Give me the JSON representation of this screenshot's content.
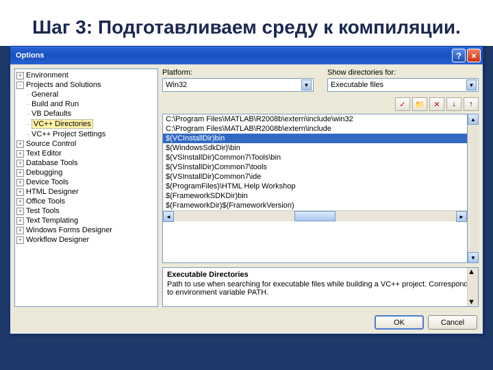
{
  "slide": {
    "title": "Шаг 3: Подготавливаем среду к компиляции."
  },
  "dialog": {
    "title": "Options",
    "help": "?",
    "close": "×"
  },
  "tree": {
    "items": [
      {
        "label": "Environment",
        "toggle": "+",
        "depth": 0
      },
      {
        "label": "Projects and Solutions",
        "toggle": "-",
        "depth": 0
      },
      {
        "label": "General",
        "toggle": "",
        "depth": 1
      },
      {
        "label": "Build and Run",
        "toggle": "",
        "depth": 1
      },
      {
        "label": "VB Defaults",
        "toggle": "",
        "depth": 1
      },
      {
        "label": "VC++ Directories",
        "toggle": "",
        "depth": 1,
        "selected": true
      },
      {
        "label": "VC++ Project Settings",
        "toggle": "",
        "depth": 1
      },
      {
        "label": "Source Control",
        "toggle": "+",
        "depth": 0
      },
      {
        "label": "Text Editor",
        "toggle": "+",
        "depth": 0
      },
      {
        "label": "Database Tools",
        "toggle": "+",
        "depth": 0
      },
      {
        "label": "Debugging",
        "toggle": "+",
        "depth": 0
      },
      {
        "label": "Device Tools",
        "toggle": "+",
        "depth": 0
      },
      {
        "label": "HTML Designer",
        "toggle": "+",
        "depth": 0
      },
      {
        "label": "Office Tools",
        "toggle": "+",
        "depth": 0
      },
      {
        "label": "Test Tools",
        "toggle": "+",
        "depth": 0
      },
      {
        "label": "Text Templating",
        "toggle": "+",
        "depth": 0
      },
      {
        "label": "Windows Forms Designer",
        "toggle": "+",
        "depth": 0
      },
      {
        "label": "Workflow Designer",
        "toggle": "+",
        "depth": 0
      }
    ]
  },
  "right": {
    "platform_label": "Platform:",
    "platform_value": "Win32",
    "showdirs_label": "Show directories for:",
    "showdirs_value": "Executable files",
    "toolbar": {
      "check": "✓",
      "new": "📁",
      "delete": "✕",
      "down": "↓",
      "up": "↑"
    },
    "paths": [
      "C:\\Program Files\\MATLAB\\R2008b\\extern\\include\\win32",
      "C:\\Program Files\\MATLAB\\R2008b\\extern\\include",
      "$(VCInstallDir)bin",
      "$(WindowsSdkDir)\\bin",
      "$(VSInstallDir)Common7\\Tools\\bin",
      "$(VSInstallDir)Common7\\tools",
      "$(VSInstallDir)Common7\\ide",
      "$(ProgramFiles)\\HTML Help Workshop",
      "$(FrameworkSDKDir)bin",
      "$(FrameworkDir)$(FrameworkVersion)"
    ],
    "selected_index": 2,
    "desc": {
      "title": "Executable Directories",
      "text": "Path to use when searching for executable files while building a VC++ project.  Corresponds to environment variable PATH."
    }
  },
  "buttons": {
    "ok": "OK",
    "cancel": "Cancel"
  }
}
